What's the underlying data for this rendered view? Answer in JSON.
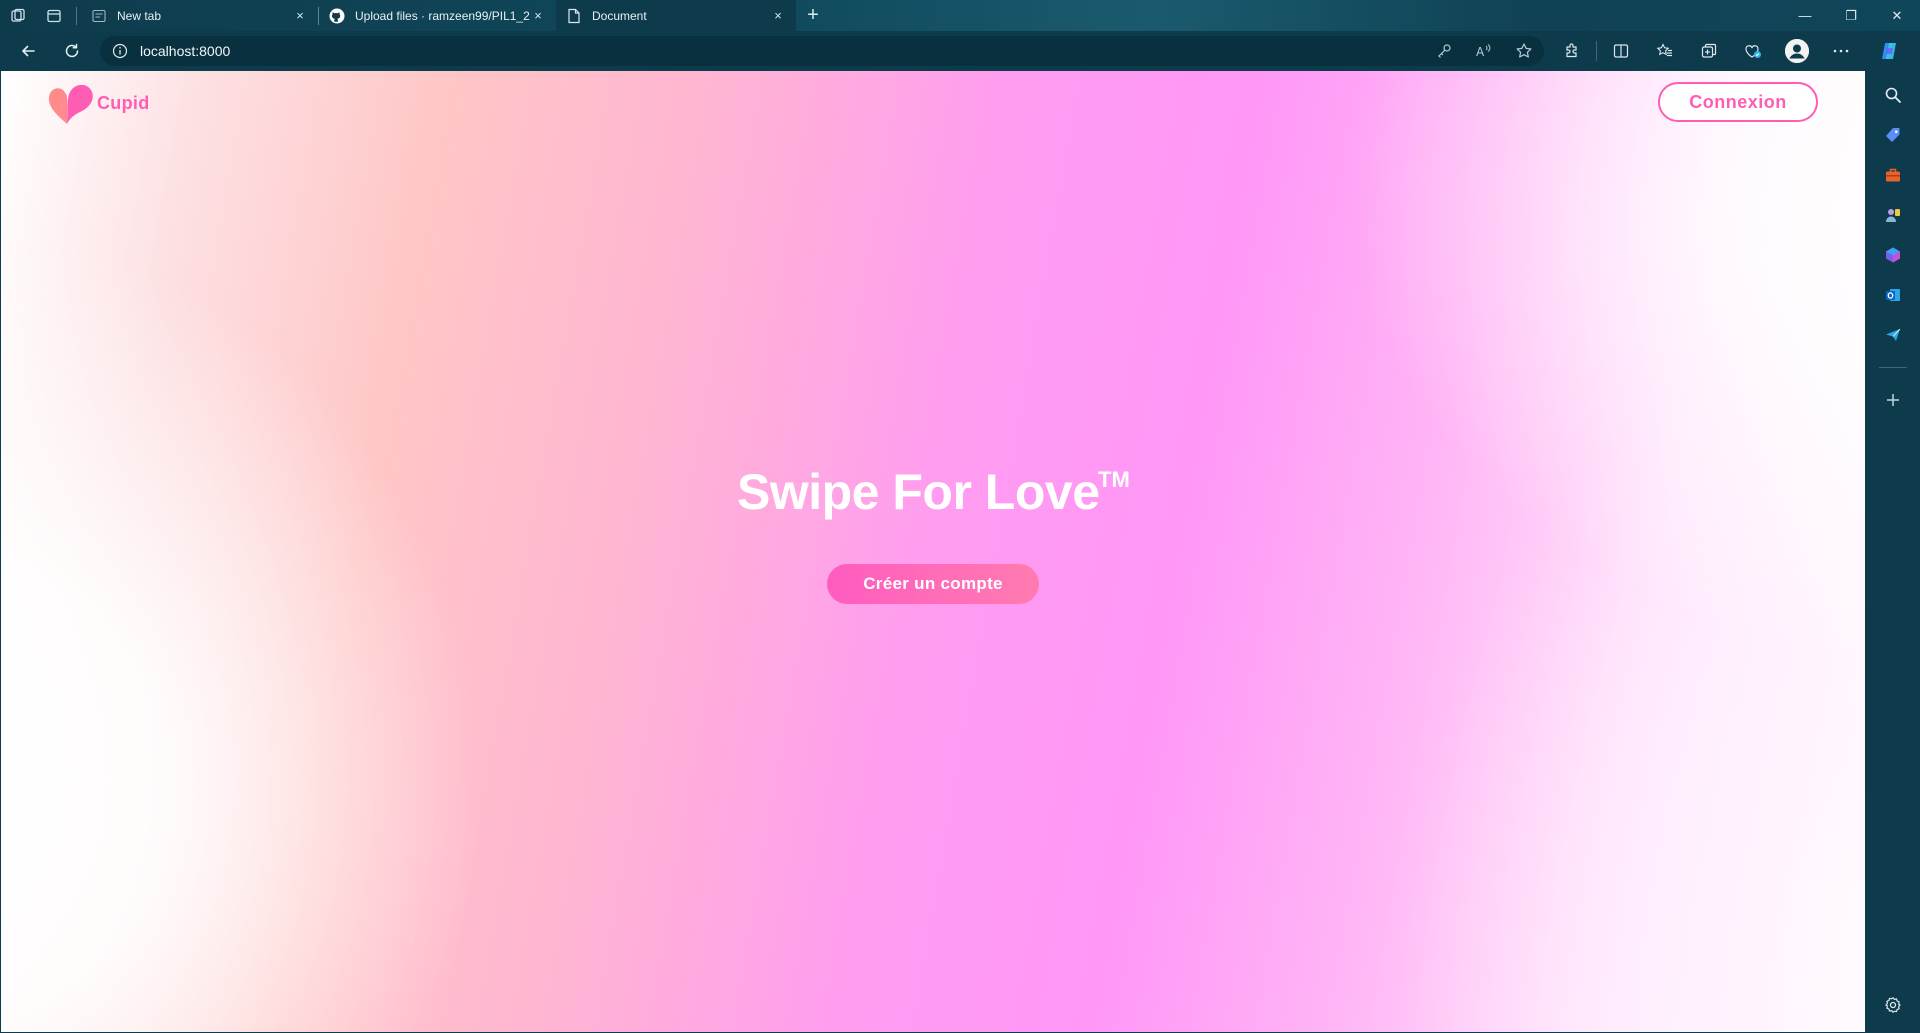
{
  "browser": {
    "tabs": [
      {
        "label": "New tab",
        "close": "×"
      },
      {
        "label": "Upload files · ramzeen99/PIL1_2",
        "close": "×"
      },
      {
        "label": "Document",
        "close": "×"
      }
    ],
    "new_tab_symbol": "+",
    "window_controls": {
      "minimize": "—",
      "restore": "❐",
      "close": "✕"
    },
    "url": "localhost:8000"
  },
  "page": {
    "logo_text": "Cupid",
    "login_button": "Connexion",
    "hero_title": "Swipe For Love",
    "trademark": "TM",
    "signup_button": "Créer un compte"
  },
  "colors": {
    "accent_pink": "#ff5cb4",
    "chrome": "#0e3b4c"
  }
}
